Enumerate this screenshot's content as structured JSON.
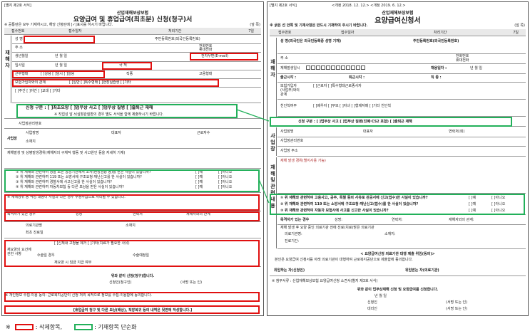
{
  "left_form": {
    "form_number": "[별지 제2호 서식]",
    "subtitle": "산업재해보상보험",
    "title": "요양급여 및 휴업급여(최초분) 신청(청구)서",
    "notice": "※ 공통란은 모두 기재하시고, 해당 신청란에 [✓]표시를 하시기 바랍니다.",
    "page": "(앞 쪽)",
    "receipt_no": "접수번호",
    "receipt_date": "접수일자",
    "process_period": "처리기간",
    "period_value": "7일",
    "side_label_worker": "재해자",
    "name_label": "성 명",
    "resident_no": "주민등록번호(외국인등록번호)",
    "address": "주 소",
    "phone": "전화번호",
    "mobile": "휴대전화",
    "email": "전자우편(E-mail)",
    "birth": "생년월일",
    "ymd": "년   월   일",
    "nationality": "국 적",
    "hire_date": "입사일",
    "work_type": "근무형태",
    "work_type_options": "[ ]주간 [ ]야간 [ ]교대 [ ]기타",
    "job": "직종",
    "hire_type": "고용형태",
    "hire_type_options": "[ ]상용 [ ]임시 [ ]일용",
    "special_worker": "보험가입자와의 관계",
    "special_options": "[ ]일반  [ ]특수형태  [ ]현장실습생  [ ]기타",
    "apply_type": "신청 구분 :  [ ]최초요양  [ ]업무상 사고  [ ]업무상 질병  [ ]출퇴근 재해",
    "apply_type_note": "※ 직업성 암·뇌심혈관질환의 경우 별도 서식을 함께 제출하시기 바랍니다.",
    "business_no": "사업장관리번호",
    "business_section": "사업장",
    "business_name": "사업장명",
    "employer": "대표자",
    "business_addr": "소재지",
    "workers_count": "근로자수",
    "accident_heading": "재해발생 및 상병발생경위(재해자의 구체적 행동 및 사고원인 등을 자세히 기재)",
    "q1": "① 위 재해와 관련하여 경찰 또는 공공기관에서 조사(현장검증 등)를 받은 사실이 있습니까?",
    "q2": "② 위 재해와 관련하여 119 또는 소방서에 구조요청·재난신고를 한 사실이 있습니까?",
    "q3": "③ 위 재해와 관련하여 경찰서에 사고신고를 한 사실이 있습니까?",
    "q4": "④ 위 재해와 관련하여 자동차보험 등 다른 보상을 받은 사실이 있습니까?",
    "yes": "[ ]예",
    "no": "[ ]아니오",
    "disclaimer": "※ 재해경위 등 작성 내용이 사실과 다른 경우 부정수급으로 처리될 수 있습니다.",
    "witness": "목격자가 있는 경우",
    "witness_name": "성명",
    "witness_phone": "연락처",
    "witness_relation": "재해자와의 관계",
    "medical_org": "의료기관명",
    "medical_addr": "소재지",
    "first_date": "최초 진료일",
    "side_label_medical": "요양",
    "care_section": "재요양의 요건에 관한 사항",
    "care_q": "[ ]신체내 고정물 제거  [ ]기타(치료가 필요한 사유)",
    "surgery": "수술일 경우",
    "surgery_date": "수술예정일",
    "wage_note": "재요양 시 임금 지급 여부",
    "sign_title": "위와 같이 신청(청구)합니다.",
    "applicant": "신청인(청구인)",
    "sign_note": "(서명 또는 인)",
    "agree_note": "※ 개인정보 수집·이용 동의: 근로복지공단이 신청 처리 목적으로 정보를 수집·이용함에 동의합니다.",
    "bottom_notice": "[휴업급여 청구 및 다른 보상(배상), 직장복귀 등의 내역은 뒷면에 작성합니다.]"
  },
  "right_form": {
    "form_number": "[별지 제2호 서식]",
    "revision": "<개정 2018. 12. 12.> <개정 2019. 6. 12.>",
    "subtitle": "산업재해보상보험",
    "title": "요양급여신청서",
    "notice": "※ 굵은 선 안쪽 및 기재사항은 반드시 기재하여 주시기 바랍니다.",
    "page": "(앞 쪽)",
    "receipt_no": "접수번호",
    "receipt_date": "접수일자",
    "process_period": "처리기간",
    "period_value": "7일",
    "side_label_worker": "재해자",
    "name_label": "성 명(외국인은 외국인등록증 성명 기재)",
    "resident_no": "주민등록번호(외국인등록번호)",
    "address": "주 소",
    "phone": "전화번호",
    "mobile": "휴대전화",
    "accident_date": "재해발생일시",
    "accident_ymd": "년   월   일",
    "hire_date": "채용일자 :",
    "hire_ymd": "년  월  일",
    "work_hours": "출근시각 :",
    "off_hours": "퇴근시각 :",
    "occupation": "직 종 :",
    "insured": "보험가입자(사업주)와의 관계",
    "insured_options": "[ ]근로자  [ ]특수형태근로종사자",
    "relation": "친인척여부",
    "relation_options": "[ ]배우자 [ ]부모 [ ]자녀 [ ]형제자매 [ ]기타 친인척",
    "apply_type": "신청 구분 :  [ ]업무상 사고   [ ]업무상 질병(진폐·CS2 포함)   [ ]출퇴근 재해",
    "side_label_business": "사업장",
    "business_name": "사업장명",
    "business_head": "대표자",
    "business_phone": "연락처(회)",
    "business_no": "사업장관리번호",
    "business_addr": "사업장 주소",
    "side_label_accident": "재해 및 관련 내용",
    "accident_heading": "재해 발생 경위(별지사용 가능)",
    "q1": "① 위 재해와 관련하여 고용사고, 공주, 특별 등의 사유로 관공서에 신고(접수)한 사실이 있습니까?",
    "q2": "② 위 재해와 관련하여 119 또는 소방서에 구조요청·재난신고(접수)를 한 사실이 있습니까?",
    "q3": "③ 위 재해와 관련하여 자동차 보험사에 사고를 신고한 사실이 있습니까?",
    "yes": "[ ]예",
    "no": "[ ]아니오",
    "witness": "목격자가 있는 경우",
    "witness_name": "성명:",
    "witness_phone": "연락처:",
    "witness_relation": "재해자와의 관계:",
    "medical_note": "재해 발생 후 요양 중인 의료기관 전에 진료(치료)받은 의료기관",
    "medical_org": "의료기관명:",
    "medical_addr": "소재지:",
    "medical_date": "진료기간:",
    "consent_heading": "< 요양급여신청 의료기관 대행 제출 위임(동의)>",
    "consent_text": "본인은 요양급여 신청서를 아래 의료기관이 대행하여 근로복지공단으로 제출함에 동의합니다.",
    "delegate": "위임하는 자(신청인)",
    "delegate_to": "위임받는 자(의료기관)",
    "footer_note": "※ 첨부서류 : 산업재해보상보험 요양급여신청 소견서(별지 제3호 서식)",
    "sign_title": "위와 같이 업무상재해 신청 및 요양급여를 신청합니다.",
    "sign_ymd": "년    월    일",
    "applicant": "신청인",
    "agent": "대리인",
    "sign_note": "(서명 또는 인)"
  },
  "legend": {
    "note_mark": "※",
    "red_label": ": 삭제항목,",
    "green_label": ": 기재항목 단순화",
    "red_color": "#e01010",
    "green_color": "#22b05a"
  },
  "connector_color": "#22b05a"
}
